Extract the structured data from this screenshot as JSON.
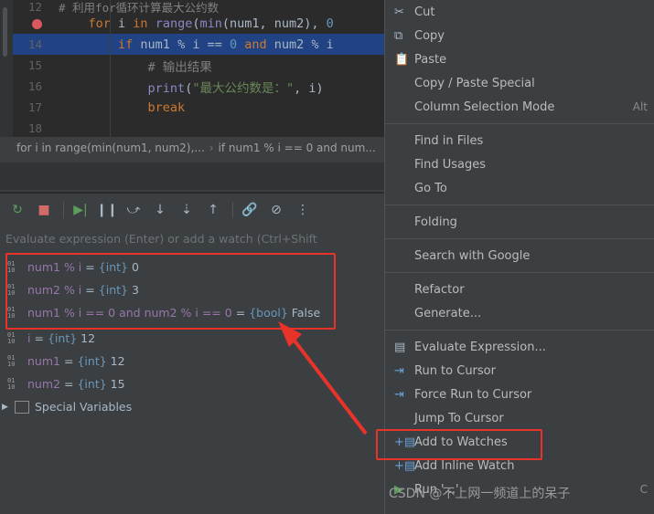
{
  "editor": {
    "partial_top_comment": "# 利用for循环计算最大公约数",
    "lines": [
      {
        "number": "12",
        "kind": "partial",
        "text": "# 利用for循环计算最大公约数"
      },
      {
        "number": "",
        "kind": "breakpoint",
        "segments": [
          {
            "t": "    ",
            "c": "plain"
          },
          {
            "t": "for",
            "c": "kw"
          },
          {
            "t": " i ",
            "c": "plain"
          },
          {
            "t": "in",
            "c": "kw"
          },
          {
            "t": " ",
            "c": "plain"
          },
          {
            "t": "range",
            "c": "fn"
          },
          {
            "t": "(",
            "c": "plain"
          },
          {
            "t": "min",
            "c": "fn"
          },
          {
            "t": "(num1, num2), ",
            "c": "plain"
          },
          {
            "t": "0",
            "c": "num"
          }
        ]
      },
      {
        "number": "14",
        "kind": "highlight",
        "segments": [
          {
            "t": "        ",
            "c": "plain"
          },
          {
            "t": "if",
            "c": "kw"
          },
          {
            "t": " num1 % i ",
            "c": "plain"
          },
          {
            "t": "==",
            "c": "plain"
          },
          {
            "t": " ",
            "c": "plain"
          },
          {
            "t": "0",
            "c": "num"
          },
          {
            "t": " ",
            "c": "plain"
          },
          {
            "t": "and",
            "c": "kw"
          },
          {
            "t": " num2 % i",
            "c": "plain"
          }
        ]
      },
      {
        "number": "15",
        "kind": "normal",
        "segments": [
          {
            "t": "            ",
            "c": "plain"
          },
          {
            "t": "# 输出结果",
            "c": "cmt"
          }
        ]
      },
      {
        "number": "16",
        "kind": "normal",
        "segments": [
          {
            "t": "            ",
            "c": "plain"
          },
          {
            "t": "print",
            "c": "fn"
          },
          {
            "t": "(",
            "c": "plain"
          },
          {
            "t": "\"最大公约数是：\"",
            "c": "str"
          },
          {
            "t": ", i)",
            "c": "plain"
          }
        ]
      },
      {
        "number": "17",
        "kind": "normal",
        "segments": [
          {
            "t": "            ",
            "c": "plain"
          },
          {
            "t": "break",
            "c": "kw"
          }
        ]
      },
      {
        "number": "18",
        "kind": "normal",
        "segments": []
      }
    ]
  },
  "breadcrumb": {
    "items": [
      "for i in range(min(num1, num2),...",
      "if num1 % i == 0 and num..."
    ]
  },
  "debug_toolbar": {
    "buttons": [
      {
        "name": "rerun-icon",
        "glyph": "↺"
      },
      {
        "name": "stop-icon",
        "glyph": "■"
      },
      {
        "name": "resume-icon",
        "glyph": "⏭"
      },
      {
        "name": "pause-icon",
        "glyph": "❙❙"
      },
      {
        "name": "step-over-icon",
        "glyph": "⤻"
      },
      {
        "name": "step-into-icon",
        "glyph": "↓"
      },
      {
        "name": "force-step-into-icon",
        "glyph": "⇣"
      },
      {
        "name": "step-out-icon",
        "glyph": "↑"
      },
      {
        "name": "link-icon",
        "glyph": "⛓"
      },
      {
        "name": "mute-breakpoints-icon",
        "glyph": "⊘"
      },
      {
        "name": "more-options-icon",
        "glyph": "⋮"
      }
    ]
  },
  "watch_input": {
    "placeholder": "Evaluate expression (Enter) or add a watch (Ctrl+Shift"
  },
  "variables": {
    "rows": [
      {
        "icon": "watch-variable-icon",
        "name": "num1 % i",
        "eq": "=",
        "type": "{int}",
        "value": "0",
        "indent": 0,
        "expandable": false
      },
      {
        "icon": "watch-variable-icon",
        "name": "num2 % i",
        "eq": "=",
        "type": "{int}",
        "value": "3",
        "indent": 0,
        "expandable": false
      },
      {
        "icon": "watch-variable-icon",
        "name": "num1 % i == 0 and num2 % i == 0",
        "eq": "=",
        "type": "{bool}",
        "value": "False",
        "indent": 0,
        "expandable": false
      },
      {
        "icon": "local-variable-icon",
        "name": "i",
        "eq": "=",
        "type": "{int}",
        "value": "12",
        "indent": 0,
        "expandable": false
      },
      {
        "icon": "local-variable-icon",
        "name": "num1",
        "eq": "=",
        "type": "{int}",
        "value": "12",
        "indent": 0,
        "expandable": false
      },
      {
        "icon": "local-variable-icon",
        "name": "num2",
        "eq": "=",
        "type": "{int}",
        "value": "15",
        "indent": 0,
        "expandable": false
      },
      {
        "icon": "special-variables-icon",
        "name": "Special Variables",
        "eq": "",
        "type": "",
        "value": "",
        "indent": 0,
        "expandable": true
      }
    ]
  },
  "context_menu": {
    "items": [
      {
        "label": "Cut",
        "icon": "cut-icon",
        "accel": "",
        "type": "item"
      },
      {
        "label": "Copy",
        "icon": "copy-icon",
        "accel": "",
        "type": "item"
      },
      {
        "label": "Paste",
        "icon": "paste-icon",
        "accel": "",
        "type": "item"
      },
      {
        "label": "Copy / Paste Special",
        "icon": "",
        "accel": "",
        "type": "item"
      },
      {
        "label": "Column Selection Mode",
        "icon": "",
        "accel": "Alt",
        "type": "item"
      },
      {
        "type": "separator"
      },
      {
        "label": "Find in Files",
        "icon": "",
        "accel": "",
        "type": "item"
      },
      {
        "label": "Find Usages",
        "icon": "",
        "accel": "",
        "type": "item"
      },
      {
        "label": "Go To",
        "icon": "",
        "accel": "",
        "type": "item"
      },
      {
        "type": "separator"
      },
      {
        "label": "Folding",
        "icon": "",
        "accel": "",
        "type": "item"
      },
      {
        "type": "separator"
      },
      {
        "label": "Search with Google",
        "icon": "",
        "accel": "",
        "type": "item"
      },
      {
        "type": "separator"
      },
      {
        "label": "Refactor",
        "icon": "",
        "accel": "",
        "type": "item"
      },
      {
        "label": "Generate...",
        "icon": "",
        "accel": "",
        "type": "item"
      },
      {
        "type": "separator"
      },
      {
        "label": "Evaluate Expression...",
        "icon": "evaluate-icon",
        "accel": "",
        "type": "item"
      },
      {
        "label": "Run to Cursor",
        "icon": "run-to-cursor-icon",
        "accel": "",
        "type": "item"
      },
      {
        "label": "Force Run to Cursor",
        "icon": "force-run-to-cursor-icon",
        "accel": "",
        "type": "item"
      },
      {
        "label": "Jump To Cursor",
        "icon": "jump-to-cursor-icon",
        "accel": "",
        "type": "item"
      },
      {
        "label": "Add to Watches",
        "icon": "add-to-watches-icon",
        "accel": "",
        "type": "item",
        "highlighted": true
      },
      {
        "label": "Add Inline Watch",
        "icon": "add-inline-watch-icon",
        "accel": "",
        "type": "item"
      },
      {
        "label": "Run '...'",
        "icon": "run-icon",
        "accel": "C",
        "type": "item"
      }
    ]
  },
  "watermark": {
    "text": "CSDN @不上网一频道上的呆子"
  },
  "colors": {
    "accent_red": "#e8332a",
    "panel_bg": "#3c3f41",
    "editor_bg": "#2b2b2b",
    "highlight_line": "#214283"
  }
}
